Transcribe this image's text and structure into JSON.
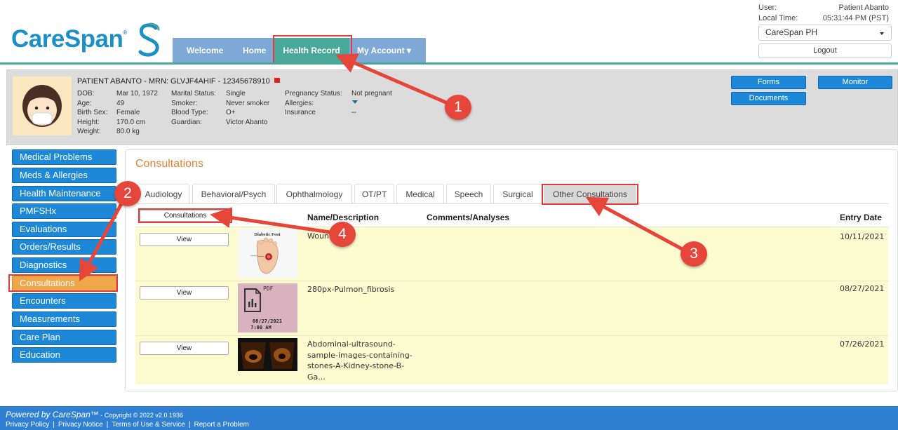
{
  "logo": {
    "word": "CareSpan",
    "reg": "®"
  },
  "nav": {
    "welcome": "Welcome",
    "home": "Home",
    "health_record": "Health Record",
    "my_account": "My Account ▾"
  },
  "user": {
    "user_label": "User:",
    "user_value": "Patient Abanto",
    "time_label": "Local Time:",
    "time_value": "05:31:44 PM (PST)",
    "org": "CareSpan PH",
    "logout": "Logout"
  },
  "patient": {
    "header": "PATIENT ABANTO - MRN: GLVJF4AHIF - 12345678910",
    "col1_labels": [
      "DOB:",
      "Age:",
      "Birth Sex:",
      "Height:",
      "Weight:"
    ],
    "col1_values": [
      "Mar 10, 1972",
      "49",
      "Female",
      "170.0 cm",
      "80.0 kg"
    ],
    "col2_labels": [
      "Marital Status:",
      "Smoker:",
      "Blood Type:",
      "Guardian:"
    ],
    "col2_values": [
      "Single",
      "Never smoker",
      "O+",
      "Victor Abanto"
    ],
    "col3_labels": [
      "Pregnancy Status:",
      "Allergies:",
      "Insurance"
    ],
    "col3_values": [
      "Not pregnant",
      "",
      "--"
    ]
  },
  "banner_buttons": {
    "forms": "Forms",
    "documents": "Documents",
    "monitor": "Monitor"
  },
  "sidebar": {
    "items": [
      "Medical Problems",
      "Meds & Allergies",
      "Health Maintenance",
      "PMFSHx",
      "Evaluations",
      "Orders/Results",
      "Diagnostics",
      "Consultations",
      "Encounters",
      "Measurements",
      "Care Plan",
      "Education"
    ],
    "active": "Consultations"
  },
  "panel": {
    "title": "Consultations",
    "tabs": [
      "Audiology",
      "Behavioral/Psych",
      "Ophthalmology",
      "OT/PT",
      "Medical",
      "Speech",
      "Surgical",
      "Other Consultations"
    ],
    "active_tab": "Other Consultations",
    "filter": "Consultations",
    "columns": {
      "name": "Name/Description",
      "comments": "Comments/Analyses",
      "date": "Entry Date"
    },
    "rows": [
      {
        "view": "View",
        "thumb_text": "Diabetic Foot",
        "name": "Wound",
        "date": "10/11/2021"
      },
      {
        "view": "View",
        "thumb_text": "PDF",
        "thumb_date": "08/27/2021",
        "thumb_time": "7:00 AM",
        "name": "280px-Pulmon_fibrosis",
        "date": "08/27/2021"
      },
      {
        "view": "View",
        "name": "Abdominal-ultrasound-sample-images-containing-stones-A-Kidney-stone-B-Ga...",
        "date": "07/26/2021"
      }
    ]
  },
  "footer": {
    "powered": "Powered by CareSpan™",
    "copyright": " - Copyright © 2022 v2.0.1936",
    "links": [
      "Privacy Policy",
      "Privacy Notice",
      "Terms of Use & Service",
      "Report a Problem"
    ]
  },
  "markers": [
    "1",
    "2",
    "3",
    "4"
  ],
  "colors": {
    "brand": "#1d8fc7",
    "nav": "#7ea9d6",
    "nav_active": "#4aa89a",
    "button": "#1e88d8",
    "active_side": "#f0a64a",
    "annotation": "#e6453a",
    "footer": "#2f7fd3"
  }
}
